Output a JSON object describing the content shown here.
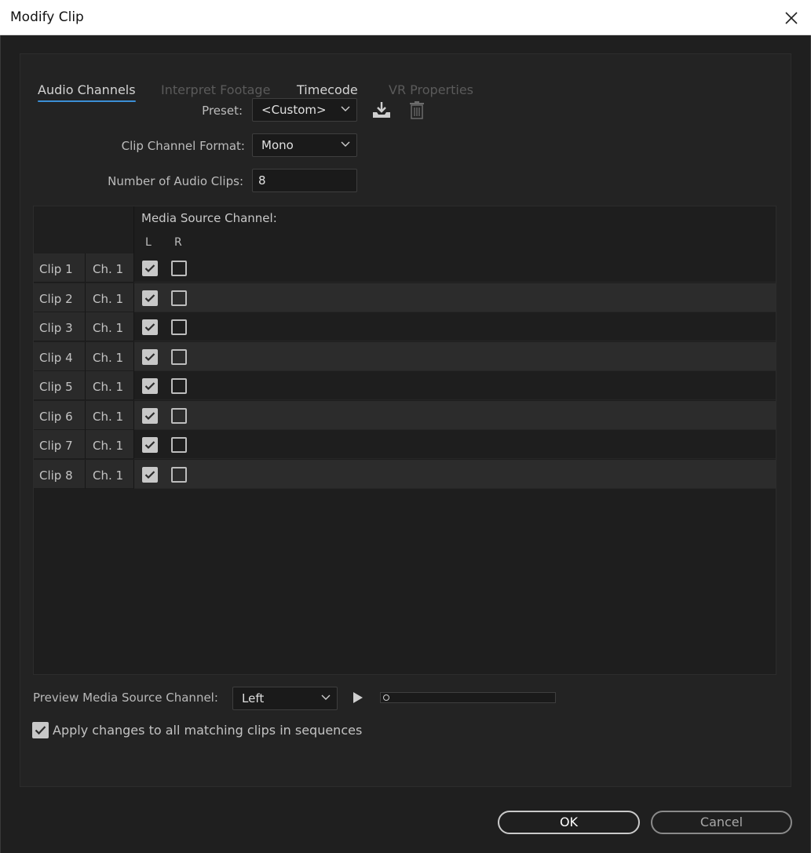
{
  "window": {
    "title": "Modify Clip"
  },
  "tabs": [
    {
      "label": "Audio Channels",
      "state": "active"
    },
    {
      "label": "Interpret Footage",
      "state": "disabled"
    },
    {
      "label": "Timecode",
      "state": "enabled"
    },
    {
      "label": "VR Properties",
      "state": "disabled"
    }
  ],
  "form": {
    "preset_label": "Preset:",
    "preset_value": "<Custom>",
    "format_label": "Clip Channel Format:",
    "format_value": "Mono",
    "num_clips_label": "Number of Audio Clips:",
    "num_clips_value": "8"
  },
  "grid": {
    "header": "Media Source Channel:",
    "columns": [
      "L",
      "R"
    ],
    "rows": [
      {
        "clip": "Clip 1",
        "channel": "Ch. 1",
        "L": true,
        "R": false
      },
      {
        "clip": "Clip 2",
        "channel": "Ch. 1",
        "L": true,
        "R": false
      },
      {
        "clip": "Clip 3",
        "channel": "Ch. 1",
        "L": true,
        "R": false
      },
      {
        "clip": "Clip 4",
        "channel": "Ch. 1",
        "L": true,
        "R": false
      },
      {
        "clip": "Clip 5",
        "channel": "Ch. 1",
        "L": true,
        "R": false
      },
      {
        "clip": "Clip 6",
        "channel": "Ch. 1",
        "L": true,
        "R": false
      },
      {
        "clip": "Clip 7",
        "channel": "Ch. 1",
        "L": true,
        "R": false
      },
      {
        "clip": "Clip 8",
        "channel": "Ch. 1",
        "L": true,
        "R": false
      }
    ]
  },
  "preview": {
    "label": "Preview Media Source Channel:",
    "value": "Left",
    "playhead_fraction": 0.0
  },
  "apply": {
    "label": "Apply changes to all matching clips in sequences",
    "checked": true
  },
  "buttons": {
    "ok": "OK",
    "cancel": "Cancel"
  },
  "colors": {
    "accent": "#3b8fd6",
    "background": "#1f1f1f"
  }
}
